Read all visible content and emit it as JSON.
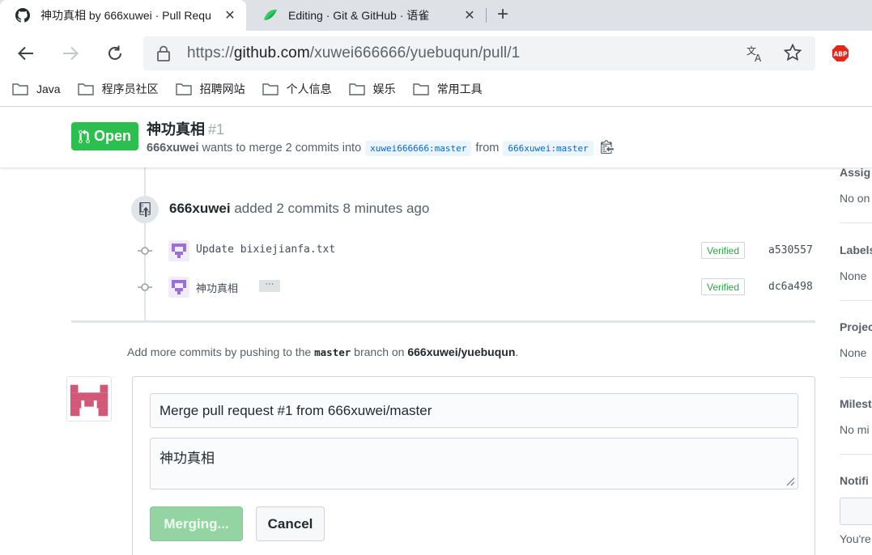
{
  "browser": {
    "tabs": [
      {
        "title": "神功真相 by 666xuwei · Pull Requ",
        "close": "✕"
      },
      {
        "title": "Editing · Git & GitHub · 语雀",
        "close": "✕"
      }
    ],
    "new_tab": "+",
    "url": {
      "scheme": "https://",
      "host": "github.com",
      "path": "/xuwei666666/yuebuqun/pull/1"
    },
    "abp_label": "ABP",
    "bookmarks": [
      "Java",
      "程序员社区",
      "招聘网站",
      "个人信息",
      "娱乐",
      "常用工具"
    ]
  },
  "pr": {
    "state": "Open",
    "title": "神功真相",
    "number": "#1",
    "author": "666xuwei",
    "merge_text": "wants to merge 2 commits into",
    "base_branch": "xuwei666666:master",
    "from_text": "from",
    "head_branch": "666xuwei:master"
  },
  "timeline": {
    "push_author": "666xuwei",
    "push_text": "added 2 commits 8 minutes ago",
    "commits": [
      {
        "message": "Update bixiejianfa.txt",
        "verified": "Verified",
        "sha": "a530557",
        "has_ellipsis": false
      },
      {
        "message": "神功真相",
        "verified": "Verified",
        "sha": "dc6a498",
        "has_ellipsis": true,
        "ellipsis": "···"
      }
    ]
  },
  "hint": {
    "prefix": "Add more commits by pushing to the",
    "branch": "master",
    "middle": "branch on",
    "repo": "666xuwei/yuebuqun",
    "suffix": "."
  },
  "merge": {
    "title_value": "Merge pull request #1 from 666xuwei/master",
    "body_value": "神功真相",
    "merge_button": "Merging...",
    "cancel_button": "Cancel"
  },
  "sidebar": {
    "assignees_label": "Assig",
    "assignees_value": "No on",
    "labels_label": "Labels",
    "labels_value": "None",
    "projects_label": "Projec",
    "projects_value": "None",
    "milestone_label": "Milest",
    "milestone_value": "No mi",
    "notifications_label": "Notifi",
    "notifications_note": "You're"
  },
  "colors": {
    "open_green": "#2cbe4e",
    "merge_disabled": "#94d3a2",
    "link_blue": "#0366d6",
    "verified_green": "#28a745"
  }
}
